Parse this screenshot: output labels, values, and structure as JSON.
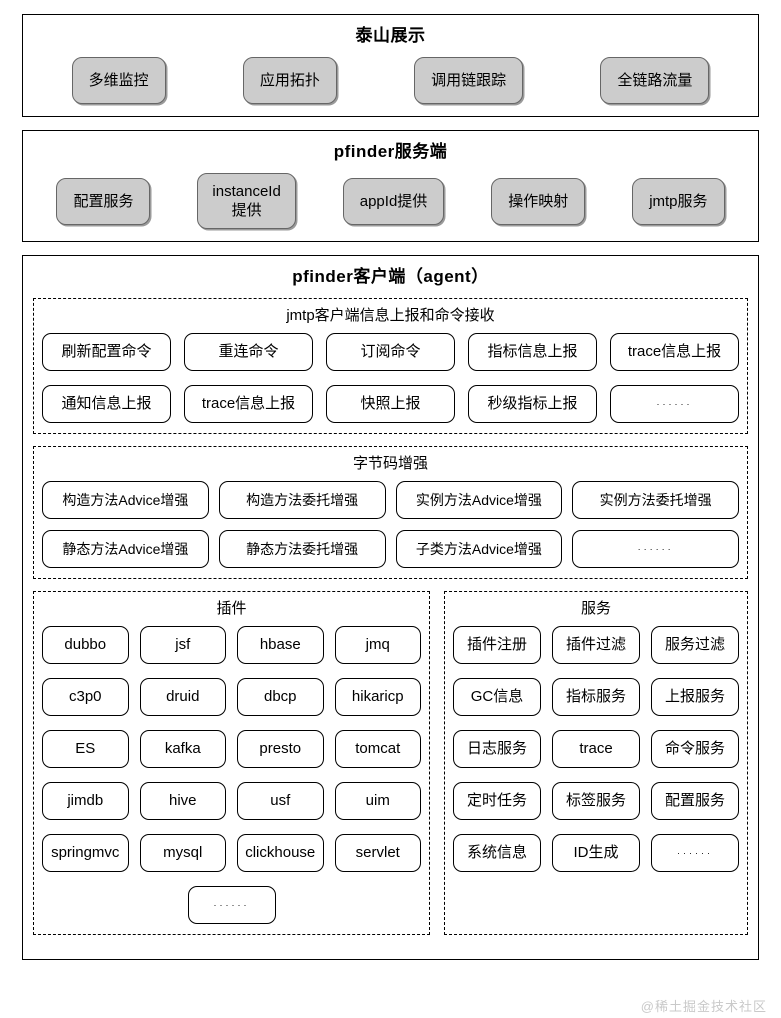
{
  "display": {
    "title": "泰山展示",
    "items": [
      "多维监控",
      "应用拓扑",
      "调用链跟踪",
      "全链路流量"
    ]
  },
  "server": {
    "title": "pfinder服务端",
    "items": [
      "配置服务",
      "instanceId\n提供",
      "appId提供",
      "操作映射",
      "jmtp服务"
    ]
  },
  "agent": {
    "title": "pfinder客户端（agent）",
    "jmtp": {
      "title": "jmtp客户端信息上报和命令接收",
      "items": [
        "刷新配置命令",
        "重连命令",
        "订阅命令",
        "指标信息上报",
        "trace信息上报",
        "通知信息上报",
        "trace信息上报",
        "快照上报",
        "秒级指标上报",
        "······"
      ]
    },
    "bytecode": {
      "title": "字节码增强",
      "items": [
        "构造方法Advice增强",
        "构造方法委托增强",
        "实例方法Advice增强",
        "实例方法委托增强",
        "静态方法Advice增强",
        "静态方法委托增强",
        "子类方法Advice增强",
        "······"
      ]
    },
    "plugins": {
      "title": "插件",
      "items": [
        "dubbo",
        "jsf",
        "hbase",
        "jmq",
        "c3p0",
        "druid",
        "dbcp",
        "hikaricp",
        "ES",
        "kafka",
        "presto",
        "tomcat",
        "jimdb",
        "hive",
        "usf",
        "uim",
        "springmvc",
        "mysql",
        "clickhouse",
        "servlet"
      ],
      "tail": "······"
    },
    "services": {
      "title": "服务",
      "items": [
        "插件注册",
        "插件过滤",
        "服务过滤",
        "GC信息",
        "指标服务",
        "上报服务",
        "日志服务",
        "trace",
        "命令服务",
        "定时任务",
        "标签服务",
        "配置服务",
        "系统信息",
        "ID生成",
        "······"
      ]
    }
  },
  "watermark": "@稀土掘金技术社区",
  "colors": {
    "chip_fill": "#cccccc",
    "border": "#000000",
    "background": "#ffffff",
    "watermark": "#c9c9c9"
  }
}
